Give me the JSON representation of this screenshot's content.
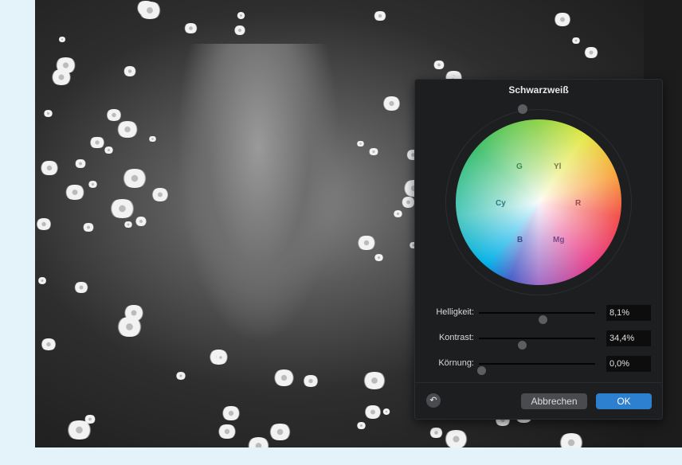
{
  "dialog": {
    "title": "Schwarzweiß",
    "wheel_labels": {
      "g": "G",
      "yl": "Yl",
      "cy": "Cy",
      "r": "R",
      "b": "B",
      "mg": "Mg"
    },
    "sliders": [
      {
        "label": "Helligkeit:",
        "value": "8,1%",
        "position": 0.55
      },
      {
        "label": "Kontrast:",
        "value": "34,4%",
        "position": 0.37
      },
      {
        "label": "Körnung:",
        "value": "0,0%",
        "position": 0.0
      }
    ],
    "cancel_label": "Abbrechen",
    "ok_label": "OK",
    "reset_icon": "↶"
  },
  "colors": {
    "accent": "#2d7fd0",
    "panel": "#1d1e20",
    "background": "#e4f2fa"
  }
}
